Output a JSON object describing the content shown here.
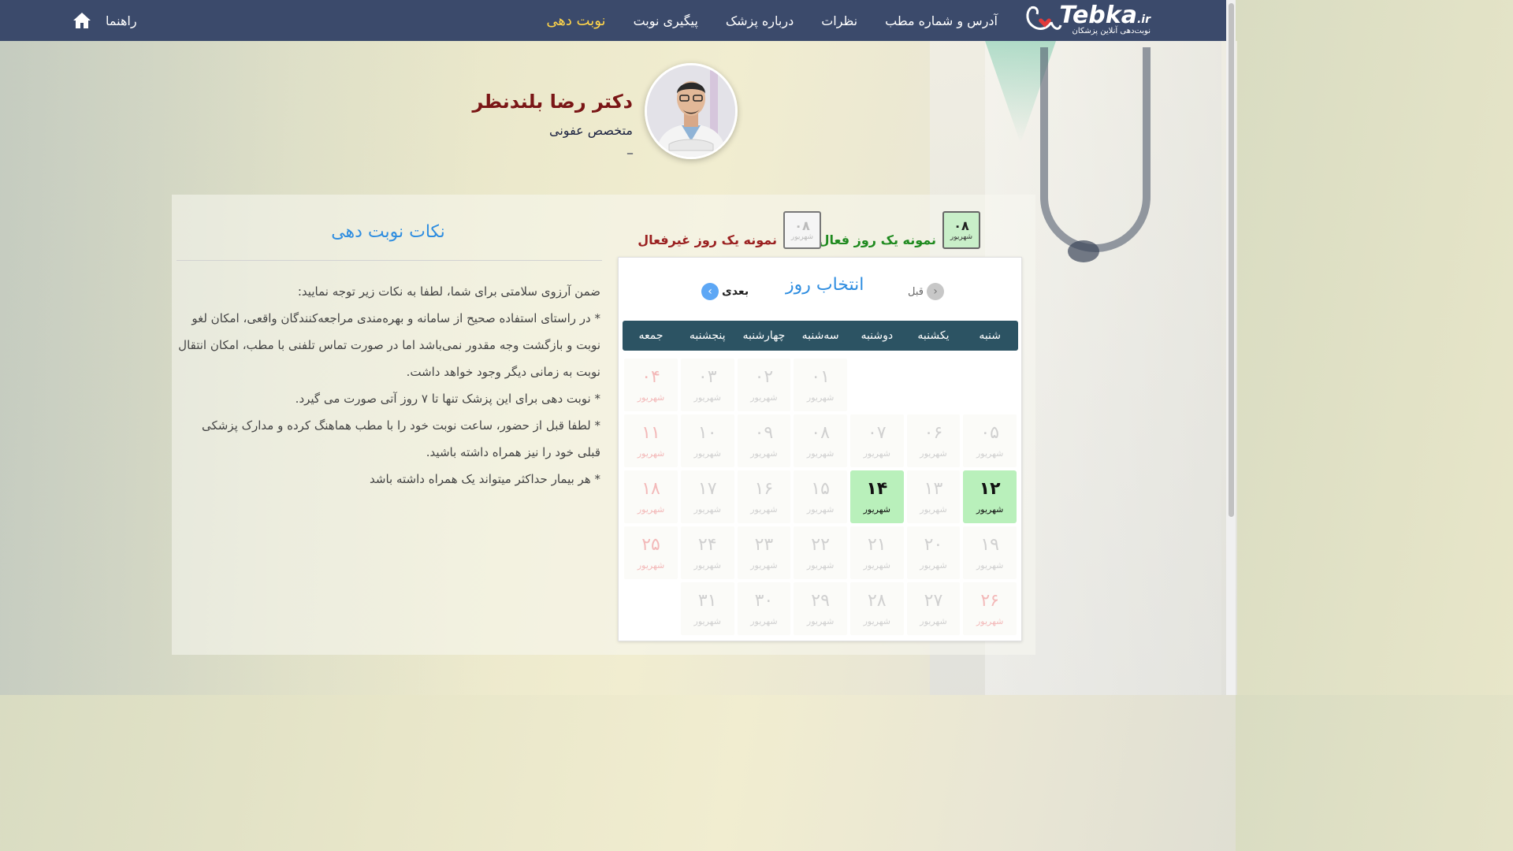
{
  "nav": {
    "logo_main": "Tebka",
    "logo_ext": ".ir",
    "logo_sub": "نوبت‌دهی آنلاین پزشکان",
    "links": [
      {
        "label": "آدرس و شماره مطب",
        "active": false
      },
      {
        "label": "نظرات",
        "active": false
      },
      {
        "label": "درباره پزشک",
        "active": false
      },
      {
        "label": "پیگیری نوبت",
        "active": false
      },
      {
        "label": "نوبت دهی",
        "active": true
      }
    ],
    "help_label": "راهنما",
    "home_icon": "home-icon"
  },
  "doctor": {
    "name": "دکتر رضا بلندنظر",
    "specialty": "متخصص عفونی",
    "extra": "_"
  },
  "notes": {
    "title": "نکات نوبت دهی",
    "lines": [
      "ضمن آرزوی سلامتی برای شما، لطفا به نکات زیر توجه نمایید:",
      "* در راستای استفاده صحیح از سامانه و بهره‌مندی مراجعه‌کنندگان واقعی، امکان لغو نوبت و بازگشت وجه مقدور نمی‌باشد اما در صورت تماس تلفنی با مطب، امکان انتقال نوبت به زمانی دیگر وجود خواهد داشت.",
      "* نوبت دهی برای این پزشک تنها تا ۷ روز آتی صورت می گیرد.",
      "* لطفا قبل از حضور، ساعت نوبت خود را با مطب هماهنگ کرده و مدارک پزشکی قبلی خود را نیز همراه داشته باشید.",
      "* هر بیمار حداکثر میتواند یک همراه داشته باشد"
    ]
  },
  "legend": {
    "active_label": "نمونه یک روز فعال",
    "inactive_label": "نمونه یک روز غیرفعال",
    "sample_day": "۰۸",
    "sample_month": "شهریور"
  },
  "calendar": {
    "title": "انتخاب روز",
    "prev_label": "قبل",
    "next_label": "بعدی",
    "weekdays": [
      "شنبه",
      "یکشنبه",
      "دوشنبه",
      "سه‌شنبه",
      "چهارشنبه",
      "پنجشنبه",
      "جمعه"
    ],
    "month": "شهریور",
    "weeks": [
      [
        null,
        null,
        null,
        {
          "d": "۰۱",
          "s": "past"
        },
        {
          "d": "۰۲",
          "s": "past"
        },
        {
          "d": "۰۳",
          "s": "past"
        },
        {
          "d": "۰۴",
          "s": "past"
        }
      ],
      [
        {
          "d": "۰۵",
          "s": "past"
        },
        {
          "d": "۰۶",
          "s": "past"
        },
        {
          "d": "۰۷",
          "s": "past"
        },
        {
          "d": "۰۸",
          "s": "past"
        },
        {
          "d": "۰۹",
          "s": "past"
        },
        {
          "d": "۱۰",
          "s": "past"
        },
        {
          "d": "۱۱",
          "s": "past"
        }
      ],
      [
        {
          "d": "۱۲",
          "s": "on"
        },
        {
          "d": "۱۳",
          "s": "past"
        },
        {
          "d": "۱۴",
          "s": "on"
        },
        {
          "d": "۱۵",
          "s": "past"
        },
        {
          "d": "۱۶",
          "s": "past"
        },
        {
          "d": "۱۷",
          "s": "past"
        },
        {
          "d": "۱۸",
          "s": "past"
        }
      ],
      [
        {
          "d": "۱۹",
          "s": "past"
        },
        {
          "d": "۲۰",
          "s": "past"
        },
        {
          "d": "۲۱",
          "s": "past"
        },
        {
          "d": "۲۲",
          "s": "past"
        },
        {
          "d": "۲۳",
          "s": "past"
        },
        {
          "d": "۲۴",
          "s": "past"
        },
        {
          "d": "۲۵",
          "s": "past"
        }
      ],
      [
        {
          "d": "۲۶",
          "s": "past",
          "red": true
        },
        {
          "d": "۲۷",
          "s": "past"
        },
        {
          "d": "۲۸",
          "s": "past"
        },
        {
          "d": "۲۹",
          "s": "past"
        },
        {
          "d": "۳۰",
          "s": "past"
        },
        {
          "d": "۳۱",
          "s": "past"
        },
        null
      ]
    ]
  },
  "colors": {
    "navbar": "#3b4a6b",
    "nav_active": "#ffd54a",
    "accent_blue": "#2e8de0",
    "active_day": "#b9f0bb",
    "weekbar": "#2c5363",
    "doctor_name": "#7a1616"
  }
}
